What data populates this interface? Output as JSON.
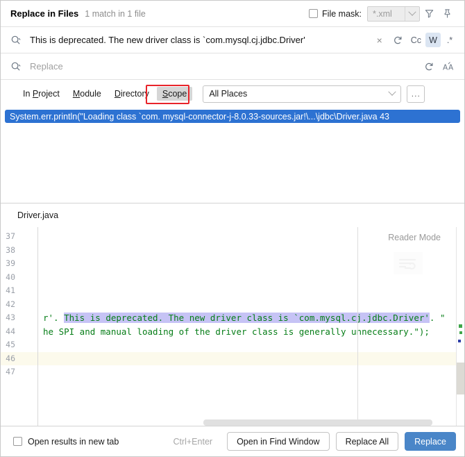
{
  "header": {
    "title": "Replace in Files",
    "match_count": "1 match in 1 file",
    "file_mask_label": "File mask:",
    "file_mask_value": "*.xml",
    "filter_icon": "filter-funnel-icon",
    "pin_icon": "pin-icon"
  },
  "search": {
    "value": "This is deprecated. The new driver class is `com.mysql.cj.jdbc.Driver'",
    "clear_label": "×",
    "history_icon": "history-icon",
    "match_case_label": "Cc",
    "words_label": "W",
    "regex_label": ".*"
  },
  "replace": {
    "placeholder": "Replace",
    "history_icon": "history-icon",
    "preserve_case_label": "ÁA"
  },
  "scope": {
    "tabs": [
      {
        "prefix": "In ",
        "mnemonic": "P",
        "suffix": "roject",
        "selected": false
      },
      {
        "prefix": "",
        "mnemonic": "M",
        "suffix": "odule",
        "selected": false
      },
      {
        "prefix": "",
        "mnemonic": "D",
        "suffix": "irectory",
        "selected": false
      },
      {
        "prefix": "",
        "mnemonic": "S",
        "suffix": "cope",
        "selected": true
      }
    ],
    "places_value": "All Places",
    "more_label": "..."
  },
  "results": {
    "rows": [
      {
        "text": "System.err.println(\"Loading class `com. mysql-connector-j-8.0.33-sources.jar!\\...\\jdbc\\Driver.java 43",
        "selected": true
      }
    ]
  },
  "preview": {
    "file_name": "Driver.java",
    "reader_mode_label": "Reader Mode",
    "lines": [
      {
        "num": "37",
        "text": "",
        "current": false,
        "icon": "override-method-icon"
      },
      {
        "num": "38",
        "text": "",
        "current": false
      },
      {
        "num": "39",
        "text": "",
        "current": false
      },
      {
        "num": "40",
        "text": "",
        "current": false
      },
      {
        "num": "41",
        "text": "",
        "current": false
      },
      {
        "num": "42",
        "text": "",
        "current": false
      },
      {
        "num": "43",
        "current": false,
        "segments": [
          {
            "t": "r'. ",
            "hl": false
          },
          {
            "t": "This is deprecated. The new driver class is `com.mysql.cj.jdbc.Driver'",
            "hl": true
          },
          {
            "t": ". \"",
            "hl": false
          }
        ]
      },
      {
        "num": "44",
        "current": false,
        "segments": [
          {
            "t": "he SPI and manual loading of the driver class is generally unnecessary.\");",
            "hl": false
          }
        ]
      },
      {
        "num": "45",
        "text": "",
        "current": false
      },
      {
        "num": "46",
        "text": "",
        "current": true
      },
      {
        "num": "47",
        "text": "",
        "current": false
      }
    ]
  },
  "footer": {
    "open_new_tab_label": "Open results in new tab",
    "shortcut": "Ctrl+Enter",
    "open_find_window_label": "Open in Find Window",
    "replace_all_label": "Replace All",
    "replace_label": "Replace"
  },
  "colors": {
    "selection_blue": "#2d72d2",
    "primary_button": "#4a86c8",
    "code_green": "#067d17",
    "match_highlight": "#c6c3f5",
    "annotation_red": "#e8242a",
    "current_line": "#fcfaec"
  }
}
